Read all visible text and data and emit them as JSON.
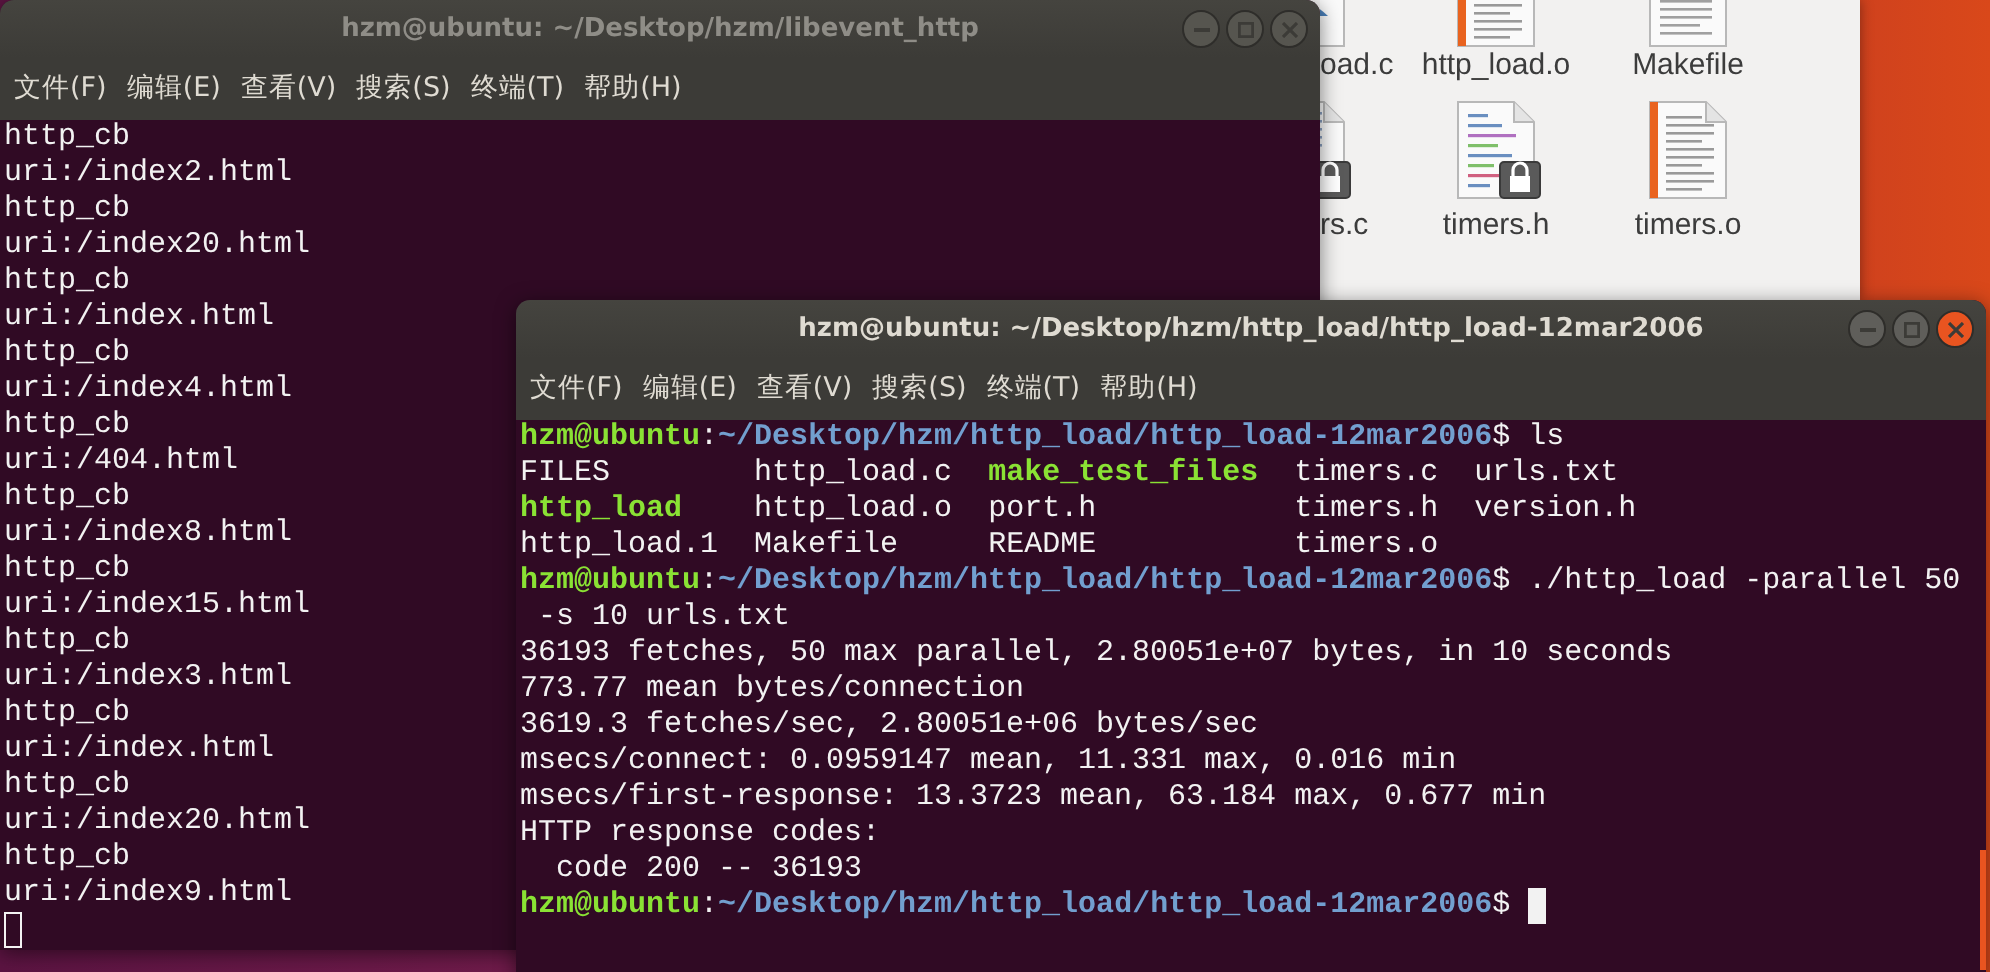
{
  "file_manager": {
    "files": [
      {
        "name": "oad.c",
        "kind": "source",
        "locked": false
      },
      {
        "name": "http_load.o",
        "kind": "object",
        "locked": false
      },
      {
        "name": "Makefile",
        "kind": "text",
        "locked": false
      },
      {
        "name": "rs.c",
        "kind": "source",
        "locked": true
      },
      {
        "name": "timers.h",
        "kind": "header",
        "locked": true
      },
      {
        "name": "timers.o",
        "kind": "object",
        "locked": false
      }
    ]
  },
  "terminals": [
    {
      "title": "hzm@ubuntu: ~/Desktop/hzm/libevent_http",
      "focused": false,
      "menu": [
        "文件(F)",
        "编辑(E)",
        "查看(V)",
        "搜索(S)",
        "终端(T)",
        "帮助(H)"
      ],
      "lines": [
        {
          "segments": [
            {
              "text": "http_cb",
              "kind": "plain"
            }
          ]
        },
        {
          "segments": [
            {
              "text": "uri:/index2.html",
              "kind": "plain"
            }
          ]
        },
        {
          "segments": [
            {
              "text": "http_cb",
              "kind": "plain"
            }
          ]
        },
        {
          "segments": [
            {
              "text": "uri:/index20.html",
              "kind": "plain"
            }
          ]
        },
        {
          "segments": [
            {
              "text": "http_cb",
              "kind": "plain"
            }
          ]
        },
        {
          "segments": [
            {
              "text": "uri:/index.html",
              "kind": "plain"
            }
          ]
        },
        {
          "segments": [
            {
              "text": "http_cb",
              "kind": "plain"
            }
          ]
        },
        {
          "segments": [
            {
              "text": "uri:/index4.html",
              "kind": "plain"
            }
          ]
        },
        {
          "segments": [
            {
              "text": "http_cb",
              "kind": "plain"
            }
          ]
        },
        {
          "segments": [
            {
              "text": "uri:/404.html",
              "kind": "plain"
            }
          ]
        },
        {
          "segments": [
            {
              "text": "http_cb",
              "kind": "plain"
            }
          ]
        },
        {
          "segments": [
            {
              "text": "uri:/index8.html",
              "kind": "plain"
            }
          ]
        },
        {
          "segments": [
            {
              "text": "http_cb",
              "kind": "plain"
            }
          ]
        },
        {
          "segments": [
            {
              "text": "uri:/index15.html",
              "kind": "plain"
            }
          ]
        },
        {
          "segments": [
            {
              "text": "http_cb",
              "kind": "plain"
            }
          ]
        },
        {
          "segments": [
            {
              "text": "uri:/index3.html",
              "kind": "plain"
            }
          ]
        },
        {
          "segments": [
            {
              "text": "http_cb",
              "kind": "plain"
            }
          ]
        },
        {
          "segments": [
            {
              "text": "uri:/index.html",
              "kind": "plain"
            }
          ]
        },
        {
          "segments": [
            {
              "text": "http_cb",
              "kind": "plain"
            }
          ]
        },
        {
          "segments": [
            {
              "text": "uri:/index20.html",
              "kind": "plain"
            }
          ]
        },
        {
          "segments": [
            {
              "text": "http_cb",
              "kind": "plain"
            }
          ]
        },
        {
          "segments": [
            {
              "text": "uri:/index9.html",
              "kind": "plain"
            }
          ]
        },
        {
          "cursor": true
        }
      ]
    },
    {
      "title": "hzm@ubuntu: ~/Desktop/hzm/http_load/http_load-12mar2006",
      "focused": true,
      "menu": [
        "文件(F)",
        "编辑(E)",
        "查看(V)",
        "搜索(S)",
        "终端(T)",
        "帮助(H)"
      ],
      "lines": [
        {
          "segments": [
            {
              "text": "hzm@ubuntu",
              "kind": "user"
            },
            {
              "text": ":",
              "kind": "plain"
            },
            {
              "text": "~/Desktop/hzm/http_load/http_load-12mar2006",
              "kind": "path"
            },
            {
              "text": "$ ls",
              "kind": "plain"
            }
          ]
        },
        {
          "listing": [
            [
              {
                "text": "FILES",
                "executable": false
              },
              {
                "text": "http_load.c",
                "executable": false
              },
              {
                "text": "make_test_files",
                "executable": true
              },
              {
                "text": "timers.c",
                "executable": false
              },
              {
                "text": "urls.txt",
                "executable": false
              }
            ],
            [
              {
                "text": "http_load",
                "executable": true
              },
              {
                "text": "http_load.o",
                "executable": false
              },
              {
                "text": "port.h",
                "executable": false
              },
              {
                "text": "timers.h",
                "executable": false
              },
              {
                "text": "version.h",
                "executable": false
              }
            ],
            [
              {
                "text": "http_load.1",
                "executable": false
              },
              {
                "text": "Makefile",
                "executable": false
              },
              {
                "text": "README",
                "executable": false
              },
              {
                "text": "timers.o",
                "executable": false
              }
            ]
          ]
        },
        {
          "segments": [
            {
              "text": "hzm@ubuntu",
              "kind": "user"
            },
            {
              "text": ":",
              "kind": "plain"
            },
            {
              "text": "~/Desktop/hzm/http_load/http_load-12mar2006",
              "kind": "path"
            },
            {
              "text": "$ ./http_load -parallel 50",
              "kind": "plain"
            }
          ]
        },
        {
          "segments": [
            {
              "text": " -s 10 urls.txt",
              "kind": "plain"
            }
          ]
        },
        {
          "segments": [
            {
              "text": "36193 fetches, 50 max parallel, 2.80051e+07 bytes, in 10 seconds",
              "kind": "plain"
            }
          ]
        },
        {
          "segments": [
            {
              "text": "773.77 mean bytes/connection",
              "kind": "plain"
            }
          ]
        },
        {
          "segments": [
            {
              "text": "3619.3 fetches/sec, 2.80051e+06 bytes/sec",
              "kind": "plain"
            }
          ]
        },
        {
          "segments": [
            {
              "text": "msecs/connect: 0.0959147 mean, 11.331 max, 0.016 min",
              "kind": "plain"
            }
          ]
        },
        {
          "segments": [
            {
              "text": "msecs/first-response: 13.3723 mean, 63.184 max, 0.677 min",
              "kind": "plain"
            }
          ]
        },
        {
          "segments": [
            {
              "text": "HTTP response codes:",
              "kind": "plain"
            }
          ]
        },
        {
          "segments": [
            {
              "text": "  code 200 -- 36193",
              "kind": "plain"
            }
          ]
        },
        {
          "segments": [
            {
              "text": "hzm@ubuntu",
              "kind": "user"
            },
            {
              "text": ":",
              "kind": "plain"
            },
            {
              "text": "~/Desktop/hzm/http_load/http_load-12mar2006",
              "kind": "path"
            },
            {
              "text": "$",
              "kind": "plain"
            }
          ],
          "cursor": true
        }
      ]
    }
  ]
}
